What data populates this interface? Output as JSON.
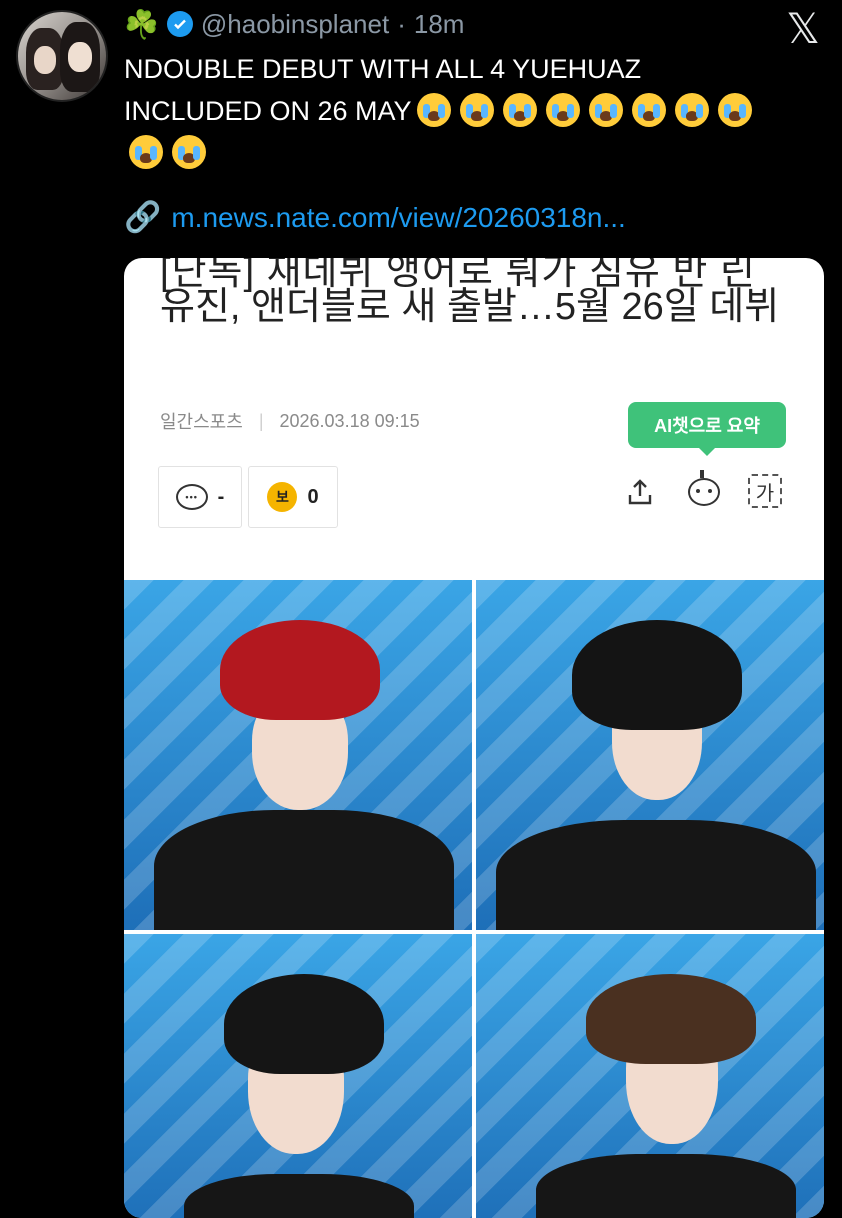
{
  "tweet": {
    "display_name_emoji": "☘️",
    "handle": "@haobinsplanet",
    "separator": "·",
    "time": "18m",
    "text_line1": "NDOUBLE DEBUT WITH ALL 4 YUEHUAZ",
    "text_line2": "INCLUDED ON 26 MAY",
    "crying_emoji_count": 10,
    "link_icon": "link-icon",
    "link_text": "m.news.nate.com/view/20260318n..."
  },
  "x_logo": "𝕏",
  "article": {
    "headline_cut": "[단독] 재데뷔 앵어로 뤄가 짐유 반 린",
    "headline": "유진, 앤더블로 새 출발…5월 26일 데뷔",
    "source": "일간스포츠",
    "meta_separator": "|",
    "date": "2026.03.18 09:15",
    "ai_pill_label": "AI챗으로 요약",
    "comment_count": "-",
    "reaction_count": "0",
    "coin_glyph": "보",
    "font_glyph": "가"
  },
  "colors": {
    "verified": "#1d9bf0",
    "link": "#1d9bf0",
    "ai_pill": "#3fc27a",
    "background": "#000000",
    "card": "#ffffff"
  },
  "photos": [
    {
      "hair": "#b3181f"
    },
    {
      "hair": "#141414"
    },
    {
      "hair": "#151515"
    },
    {
      "hair": "#4a3020"
    }
  ]
}
